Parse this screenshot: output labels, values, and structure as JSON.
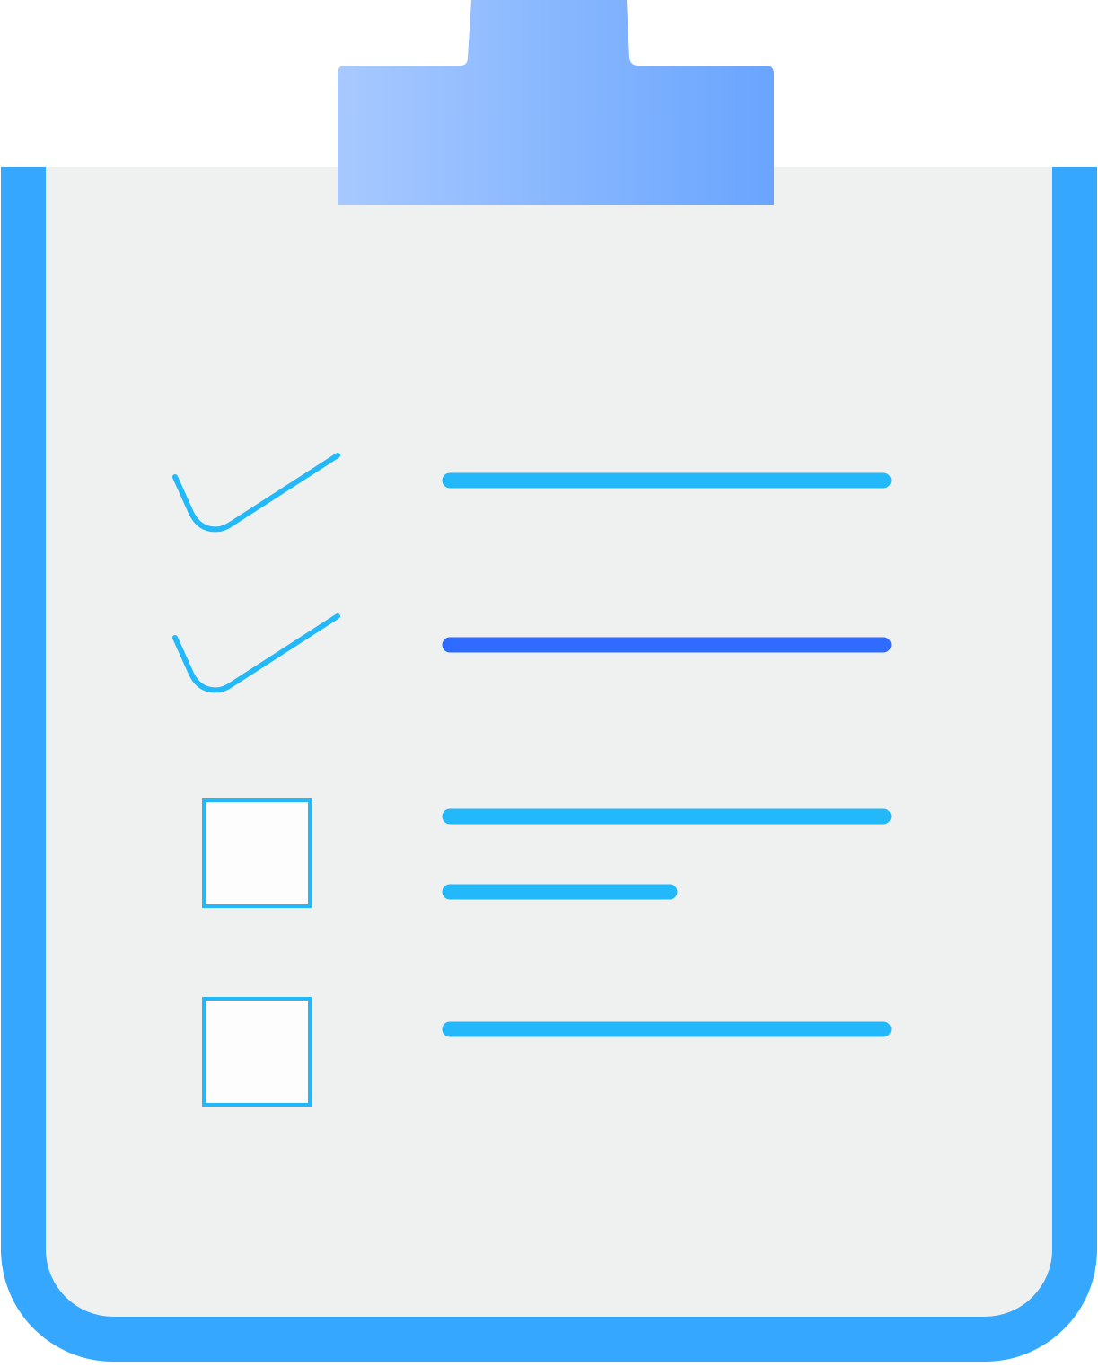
{
  "colors": {
    "background": "#ffffff",
    "board_frame": "#35a7fe",
    "paper": "#eff1f1",
    "clip_gradient_start": "#a8c9ff",
    "clip_gradient_end": "#69a5fe",
    "check_stroke": "#22b8f9",
    "line_default": "#22b8f9",
    "line_highlight": "#2f6bfe",
    "checkbox_fill": "#fdfdfd",
    "checkbox_border": "#22b8f9"
  },
  "checklist": {
    "items": [
      {
        "state": "checked",
        "icon": "checkmark-icon",
        "text_lines": 1,
        "highlighted": false
      },
      {
        "state": "checked",
        "icon": "checkmark-icon",
        "text_lines": 1,
        "highlighted": true
      },
      {
        "state": "unchecked",
        "icon": "empty-checkbox-icon",
        "text_lines": 2,
        "highlighted": false
      },
      {
        "state": "unchecked",
        "icon": "empty-checkbox-icon",
        "text_lines": 1,
        "highlighted": false
      }
    ]
  }
}
